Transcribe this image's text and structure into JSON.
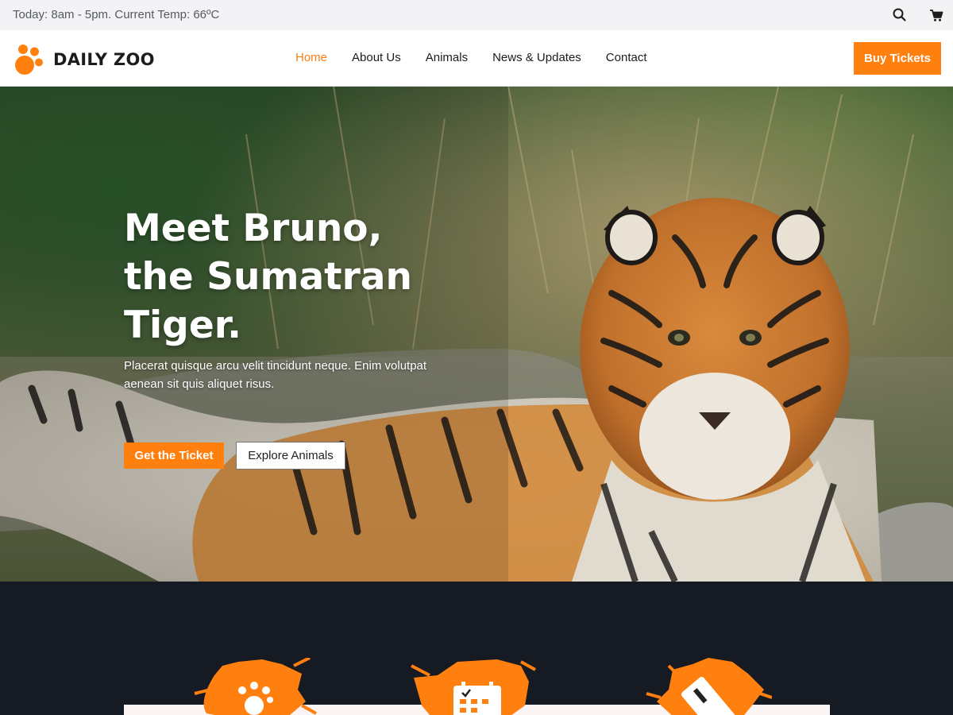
{
  "topbar": {
    "info": "Today: 8am - 5pm. Current Temp: 66ºC",
    "search_icon": "search-icon",
    "cart_icon": "cart-icon"
  },
  "header": {
    "brand": "DAILY ZOO",
    "logo_icon": "paw-icon",
    "nav": [
      "Home",
      "About Us",
      "Animals",
      "News & Updates",
      "Contact"
    ],
    "active_nav": "Home",
    "buy_button": "Buy Tickets"
  },
  "hero": {
    "title_line1": "Meet Bruno,",
    "title_line2": "the Sumatran",
    "title_line3": "Tiger.",
    "description": "Placerat quisque arcu velit tincidunt neque. Enim volutpat aenean sit quis aliquet risus.",
    "primary_button": "Get the Ticket",
    "secondary_button": "Explore Animals",
    "image_subject": "tiger lying in grass"
  },
  "features": {
    "icons": [
      "paw-icon",
      "calendar-icon",
      "ticket-icon"
    ]
  },
  "colors": {
    "accent": "#ff7f0f",
    "nav_active": "#f57f17",
    "dark_section": "#151a23",
    "topbar_bg": "#f3f3f5"
  }
}
